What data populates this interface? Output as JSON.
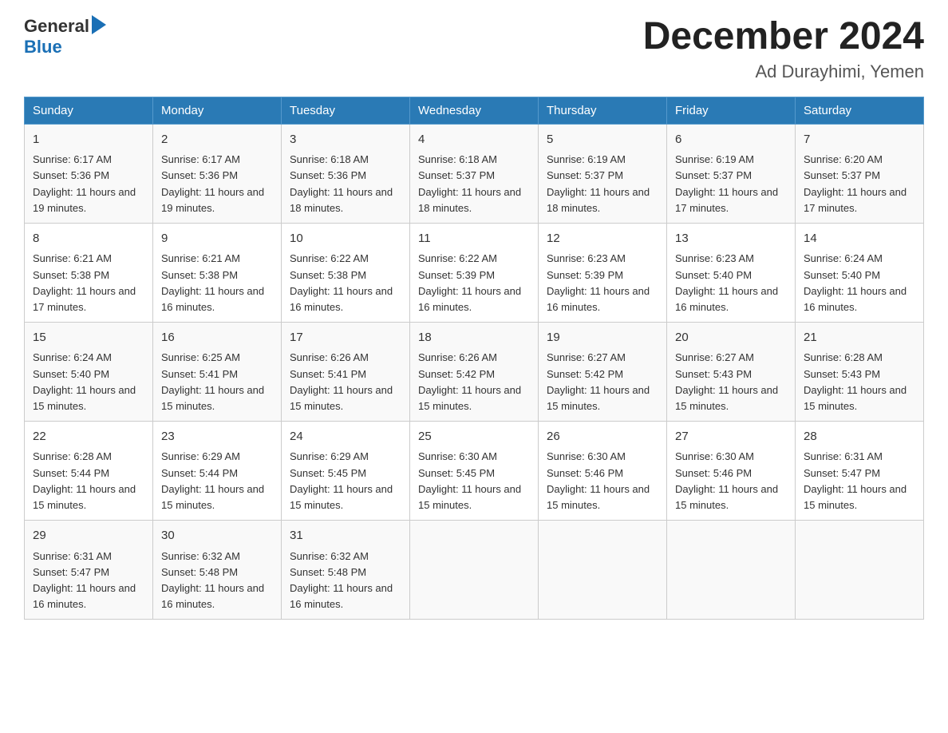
{
  "header": {
    "logo_general": "General",
    "logo_blue": "Blue",
    "month_title": "December 2024",
    "location": "Ad Durayhimi, Yemen"
  },
  "weekdays": [
    "Sunday",
    "Monday",
    "Tuesday",
    "Wednesday",
    "Thursday",
    "Friday",
    "Saturday"
  ],
  "weeks": [
    [
      {
        "day": "1",
        "sunrise": "6:17 AM",
        "sunset": "5:36 PM",
        "daylight": "11 hours and 19 minutes."
      },
      {
        "day": "2",
        "sunrise": "6:17 AM",
        "sunset": "5:36 PM",
        "daylight": "11 hours and 19 minutes."
      },
      {
        "day": "3",
        "sunrise": "6:18 AM",
        "sunset": "5:36 PM",
        "daylight": "11 hours and 18 minutes."
      },
      {
        "day": "4",
        "sunrise": "6:18 AM",
        "sunset": "5:37 PM",
        "daylight": "11 hours and 18 minutes."
      },
      {
        "day": "5",
        "sunrise": "6:19 AM",
        "sunset": "5:37 PM",
        "daylight": "11 hours and 18 minutes."
      },
      {
        "day": "6",
        "sunrise": "6:19 AM",
        "sunset": "5:37 PM",
        "daylight": "11 hours and 17 minutes."
      },
      {
        "day": "7",
        "sunrise": "6:20 AM",
        "sunset": "5:37 PM",
        "daylight": "11 hours and 17 minutes."
      }
    ],
    [
      {
        "day": "8",
        "sunrise": "6:21 AM",
        "sunset": "5:38 PM",
        "daylight": "11 hours and 17 minutes."
      },
      {
        "day": "9",
        "sunrise": "6:21 AM",
        "sunset": "5:38 PM",
        "daylight": "11 hours and 16 minutes."
      },
      {
        "day": "10",
        "sunrise": "6:22 AM",
        "sunset": "5:38 PM",
        "daylight": "11 hours and 16 minutes."
      },
      {
        "day": "11",
        "sunrise": "6:22 AM",
        "sunset": "5:39 PM",
        "daylight": "11 hours and 16 minutes."
      },
      {
        "day": "12",
        "sunrise": "6:23 AM",
        "sunset": "5:39 PM",
        "daylight": "11 hours and 16 minutes."
      },
      {
        "day": "13",
        "sunrise": "6:23 AM",
        "sunset": "5:40 PM",
        "daylight": "11 hours and 16 minutes."
      },
      {
        "day": "14",
        "sunrise": "6:24 AM",
        "sunset": "5:40 PM",
        "daylight": "11 hours and 16 minutes."
      }
    ],
    [
      {
        "day": "15",
        "sunrise": "6:24 AM",
        "sunset": "5:40 PM",
        "daylight": "11 hours and 15 minutes."
      },
      {
        "day": "16",
        "sunrise": "6:25 AM",
        "sunset": "5:41 PM",
        "daylight": "11 hours and 15 minutes."
      },
      {
        "day": "17",
        "sunrise": "6:26 AM",
        "sunset": "5:41 PM",
        "daylight": "11 hours and 15 minutes."
      },
      {
        "day": "18",
        "sunrise": "6:26 AM",
        "sunset": "5:42 PM",
        "daylight": "11 hours and 15 minutes."
      },
      {
        "day": "19",
        "sunrise": "6:27 AM",
        "sunset": "5:42 PM",
        "daylight": "11 hours and 15 minutes."
      },
      {
        "day": "20",
        "sunrise": "6:27 AM",
        "sunset": "5:43 PM",
        "daylight": "11 hours and 15 minutes."
      },
      {
        "day": "21",
        "sunrise": "6:28 AM",
        "sunset": "5:43 PM",
        "daylight": "11 hours and 15 minutes."
      }
    ],
    [
      {
        "day": "22",
        "sunrise": "6:28 AM",
        "sunset": "5:44 PM",
        "daylight": "11 hours and 15 minutes."
      },
      {
        "day": "23",
        "sunrise": "6:29 AM",
        "sunset": "5:44 PM",
        "daylight": "11 hours and 15 minutes."
      },
      {
        "day": "24",
        "sunrise": "6:29 AM",
        "sunset": "5:45 PM",
        "daylight": "11 hours and 15 minutes."
      },
      {
        "day": "25",
        "sunrise": "6:30 AM",
        "sunset": "5:45 PM",
        "daylight": "11 hours and 15 minutes."
      },
      {
        "day": "26",
        "sunrise": "6:30 AM",
        "sunset": "5:46 PM",
        "daylight": "11 hours and 15 minutes."
      },
      {
        "day": "27",
        "sunrise": "6:30 AM",
        "sunset": "5:46 PM",
        "daylight": "11 hours and 15 minutes."
      },
      {
        "day": "28",
        "sunrise": "6:31 AM",
        "sunset": "5:47 PM",
        "daylight": "11 hours and 15 minutes."
      }
    ],
    [
      {
        "day": "29",
        "sunrise": "6:31 AM",
        "sunset": "5:47 PM",
        "daylight": "11 hours and 16 minutes."
      },
      {
        "day": "30",
        "sunrise": "6:32 AM",
        "sunset": "5:48 PM",
        "daylight": "11 hours and 16 minutes."
      },
      {
        "day": "31",
        "sunrise": "6:32 AM",
        "sunset": "5:48 PM",
        "daylight": "11 hours and 16 minutes."
      },
      null,
      null,
      null,
      null
    ]
  ]
}
